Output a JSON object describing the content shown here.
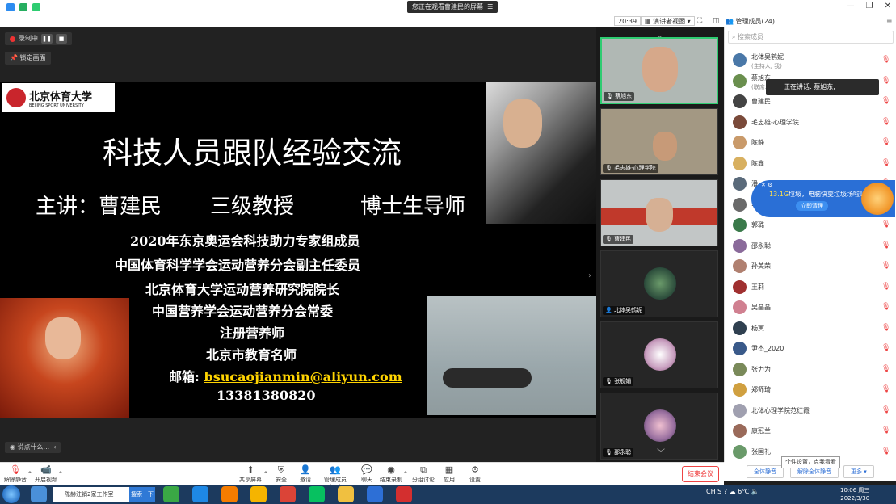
{
  "titlebar": {
    "notice": "您正在观看曹建民的屏幕",
    "notice_icon": "menu-icon",
    "time": "20:39",
    "view_label": "演讲者视图",
    "participants_title": "管理成员(24)"
  },
  "main": {
    "recording_label": "录制中",
    "lock_label": "锁定画面",
    "chat_hint": "说点什么..."
  },
  "slide": {
    "logo_cn": "北京体育大学",
    "logo_en": "BEIJING SPORT UNIVERSITY",
    "title": "科技人员跟队经验交流",
    "speaker_label": "主讲：曹建民",
    "speaker_rank": "三级教授",
    "speaker_role": "博士生导师",
    "lines": [
      "2020年东京奥运会科技助力专家组成员",
      "中国体育科学学会运动营养分会副主任委员",
      "北京体育大学运动营养研究院院长",
      "中国营养学会运动营养分会常委",
      "注册营养师",
      "北京市教育名师"
    ],
    "email_label": "邮箱:",
    "email": "bsucaojianmin@aliyun.com",
    "phone": "13381380820"
  },
  "gallery": {
    "tiles": [
      {
        "name": "蔡旭东"
      },
      {
        "name": "毛志雄-心理学院"
      },
      {
        "name": "曹建民"
      },
      {
        "name": "北体吴鹤妮"
      },
      {
        "name": "张舰娟"
      },
      {
        "name": "邵永聪"
      }
    ]
  },
  "panel": {
    "search_placeholder": "搜索成员",
    "speaking_label": "正在讲话: 蔡旭东;",
    "participants": [
      {
        "name": "北体吴鹤妮",
        "sub": "(主持人, 我)",
        "color": "#4a78a8"
      },
      {
        "name": "蔡旭东",
        "sub": "(联席...",
        "color": "#6a8f4e"
      },
      {
        "name": "曹建民",
        "sub": "",
        "color": "#444444"
      },
      {
        "name": "毛志雄-心理学院",
        "sub": "",
        "color": "#7a4a3a"
      },
      {
        "name": "陈静",
        "sub": "",
        "color": "#c99a6a"
      },
      {
        "name": "陈鑫",
        "sub": "",
        "color": "#d8b060"
      },
      {
        "name": "潘...",
        "sub": "",
        "color": "#5a6a7a"
      },
      {
        "name": "...",
        "sub": "",
        "color": "#6a6a6a"
      },
      {
        "name": "郭璐",
        "sub": "",
        "color": "#3a7a4a"
      },
      {
        "name": "邵永聪",
        "sub": "",
        "color": "#8a6a9a"
      },
      {
        "name": "孙美荣",
        "sub": "",
        "color": "#b08070"
      },
      {
        "name": "王莉",
        "sub": "",
        "color": "#a03030"
      },
      {
        "name": "吴晶晶",
        "sub": "",
        "color": "#d08090"
      },
      {
        "name": "杨寅",
        "sub": "",
        "color": "#304050"
      },
      {
        "name": "尹杰_2020",
        "sub": "",
        "color": "#3a5a8a"
      },
      {
        "name": "张力为",
        "sub": "",
        "color": "#7a8a5a"
      },
      {
        "name": "郑筛琦",
        "sub": "",
        "color": "#d0a040"
      },
      {
        "name": "北体心理学院范红霞",
        "sub": "",
        "color": "#a0a0b0"
      },
      {
        "name": "康冠兰",
        "sub": "",
        "color": "#9a6a5a"
      },
      {
        "name": "张国礼",
        "sub": "",
        "color": "#6a9a6a"
      }
    ],
    "tooltip": "个性设置，点我看看",
    "btn_mute_all": "全体静音",
    "btn_unmute_all": "解除全体静音",
    "btn_more": "更多"
  },
  "junk_popup": {
    "size": "13.1G",
    "text": "垃圾，电脑快变垃圾场啦！",
    "button": "立即清理"
  },
  "controls": {
    "unmute": "解除静音",
    "video": "开启视频",
    "share": "共享屏幕",
    "security": "安全",
    "invite": "邀请",
    "members": "管理成员(24)",
    "chat": "聊天",
    "record": "结束录制",
    "breakout": "分组讨论",
    "apps": "应用",
    "settings": "设置",
    "end": "结束会议"
  },
  "taskbar": {
    "search_text": "陈赫注销2家工作室",
    "search_btn": "搜索一下",
    "tray": "CH  S ? ",
    "temp": "6℃",
    "time": "10:06 周三",
    "date": "2022/3/30"
  }
}
